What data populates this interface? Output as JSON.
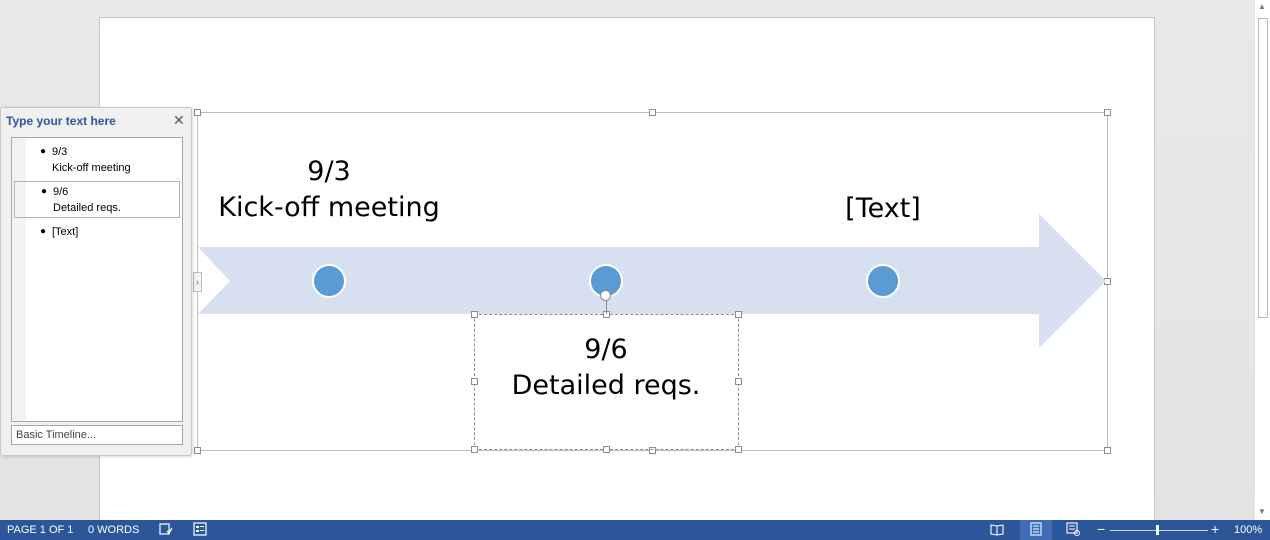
{
  "text_pane": {
    "title": "Type your text here",
    "close_icon": "close-icon",
    "items": [
      {
        "date": "9/3",
        "desc": "Kick-off meeting"
      },
      {
        "date": "9/6",
        "desc": "Detailed reqs."
      },
      {
        "date": "[Text]",
        "desc": ""
      }
    ],
    "layout_name": "Basic Timeline..."
  },
  "smartart": {
    "milestones": [
      {
        "date": "9/3",
        "desc": "Kick-off meeting"
      },
      {
        "date": "9/6",
        "desc": "Detailed reqs."
      },
      {
        "date": "[Text]",
        "desc": ""
      }
    ],
    "arrow_color": "#d6e0f0",
    "dot_color": "#5b9bd5"
  },
  "statusbar": {
    "page": "PAGE 1 OF 1",
    "words": "0 WORDS",
    "zoom": "100%",
    "zoom_out": "−",
    "zoom_in": "+",
    "color": "#2b579a"
  }
}
